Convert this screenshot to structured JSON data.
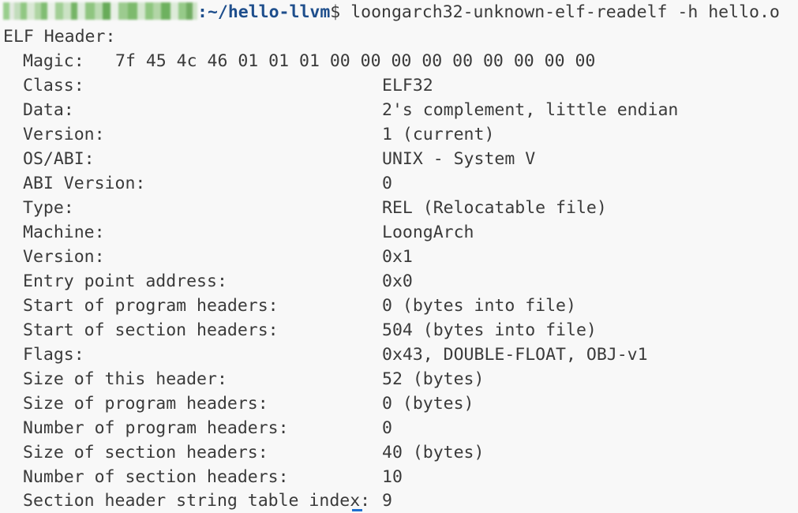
{
  "prompt": {
    "separator": ":",
    "path": "~/hello-llvm",
    "dollar": "$",
    "command": " loongarch32-unknown-elf-readelf -h hello.o"
  },
  "header_title": "ELF Header:",
  "magic": {
    "label": "Magic:",
    "bytes": "7f 45 4c 46 01 01 01 00 00 00 00 00 00 00 00 00"
  },
  "fields": [
    {
      "label": "Class:",
      "value": "ELF32"
    },
    {
      "label": "Data:",
      "value": "2's complement, little endian"
    },
    {
      "label": "Version:",
      "value": "1 (current)"
    },
    {
      "label": "OS/ABI:",
      "value": "UNIX - System V"
    },
    {
      "label": "ABI Version:",
      "value": "0"
    },
    {
      "label": "Type:",
      "value": "REL (Relocatable file)"
    },
    {
      "label": "Machine:",
      "value": "LoongArch"
    },
    {
      "label": "Version:",
      "value": "0x1"
    },
    {
      "label": "Entry point address:",
      "value": "0x0"
    },
    {
      "label": "Start of program headers:",
      "value": "0 (bytes into file)"
    },
    {
      "label": "Start of section headers:",
      "value": "504 (bytes into file)"
    },
    {
      "label": "Flags:",
      "value": "0x43, DOUBLE-FLOAT, OBJ-v1"
    },
    {
      "label": "Size of this header:",
      "value": "52 (bytes)"
    },
    {
      "label": "Size of program headers:",
      "value": "0 (bytes)"
    },
    {
      "label": "Number of program headers:",
      "value": "0"
    },
    {
      "label": "Size of section headers:",
      "value": "40 (bytes)"
    },
    {
      "label": "Number of section headers:",
      "value": "10"
    },
    {
      "label": "Section header string table index:",
      "value": "9"
    }
  ]
}
